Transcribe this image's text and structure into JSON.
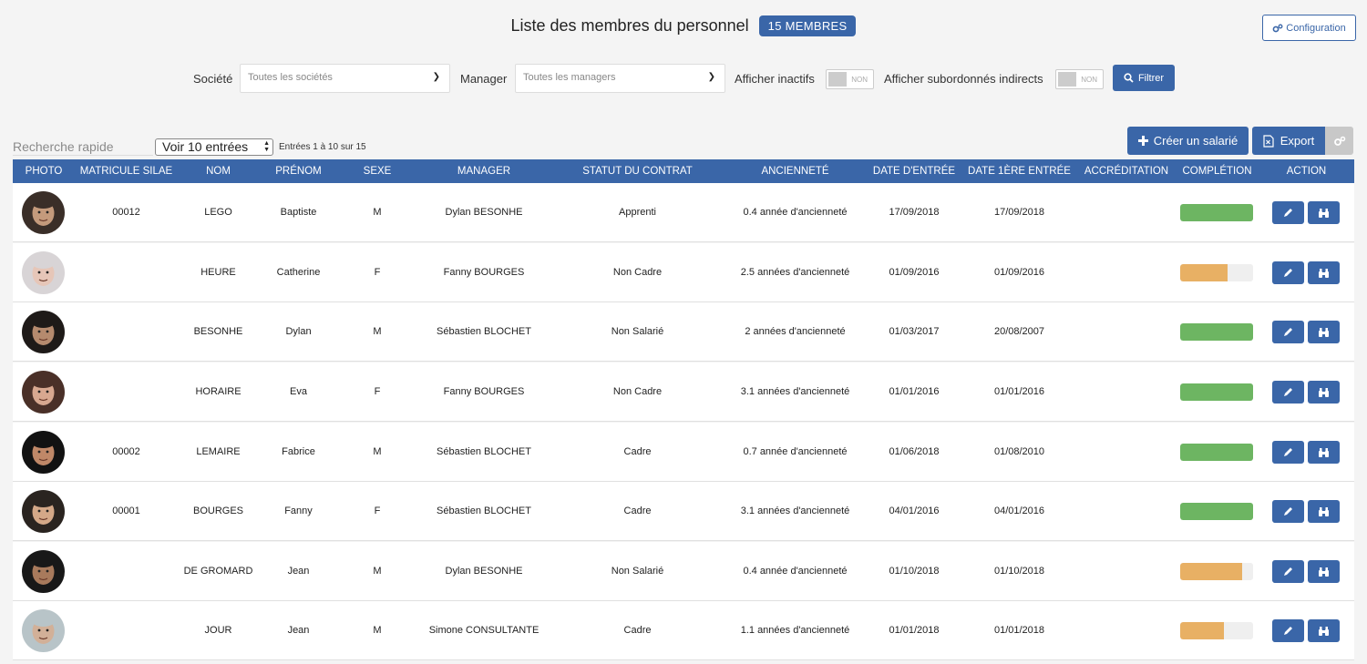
{
  "header": {
    "title": "Liste des membres du personnel",
    "badge": "15 MEMBRES",
    "config_label": "Configuration"
  },
  "filters": {
    "societe_label": "Société",
    "societe_value": "Toutes les sociétés",
    "manager_label": "Manager",
    "manager_value": "Toutes les managers",
    "inactifs_label": "Afficher inactifs",
    "inactifs_toggle": "NON",
    "subordonnes_label": "Afficher subordonnés indirects",
    "subordonnes_toggle": "NON",
    "filter_button": "Filtrer"
  },
  "table_controls": {
    "search_placeholder": "Recherche rapide",
    "length_select": "Voir 10 entrées",
    "entries_info": "Entrées 1 à 10 sur 15",
    "create_button": "Créer un salarié",
    "export_button": "Export"
  },
  "columns": [
    "PHOTO",
    "MATRICULE SILAE",
    "NOM",
    "PRÉNOM",
    "SEXE",
    "MANAGER",
    "STATUT DU CONTRAT",
    "ANCIENNETÉ",
    "DATE D'ENTRÉE",
    "DATE 1ÈRE ENTRÉE",
    "ACCRÉDITATION",
    "COMPLÉTION",
    "ACTION"
  ],
  "colors": {
    "primary": "#3a66a8",
    "complete": "#6db562",
    "partial": "#e8b064",
    "background": "#f4f4f4"
  },
  "rows": [
    {
      "matricule": "00012",
      "nom": "LEGO",
      "prenom": "Baptiste",
      "sexe": "M",
      "manager": "Dylan BESONHE",
      "statut": "Apprenti",
      "anciennete": "0.4 année d'ancienneté",
      "date_entree": "17/09/2018",
      "date_premiere": "17/09/2018",
      "accreditation": "",
      "completion": 1.0,
      "bg": "#3a2e28",
      "skin": "#c49a7c"
    },
    {
      "matricule": "",
      "nom": "HEURE",
      "prenom": "Catherine",
      "sexe": "F",
      "manager": "Fanny BOURGES",
      "statut": "Non Cadre",
      "anciennete": "2.5 années d'ancienneté",
      "date_entree": "01/09/2016",
      "date_premiere": "01/09/2016",
      "accreditation": "",
      "completion": 0.65,
      "bg": "#d8d4d6",
      "skin": "#e6c6b8"
    },
    {
      "matricule": "",
      "nom": "BESONHE",
      "prenom": "Dylan",
      "sexe": "M",
      "manager": "Sébastien BLOCHET",
      "statut": "Non Salarié",
      "anciennete": "2 années d'ancienneté",
      "date_entree": "01/03/2017",
      "date_premiere": "20/08/2007",
      "accreditation": "",
      "completion": 1.0,
      "bg": "#1e1a18",
      "skin": "#b58a6e"
    },
    {
      "matricule": "",
      "nom": "HORAIRE",
      "prenom": "Eva",
      "sexe": "F",
      "manager": "Fanny BOURGES",
      "statut": "Non Cadre",
      "anciennete": "3.1 années d'ancienneté",
      "date_entree": "01/01/2016",
      "date_premiere": "01/01/2016",
      "accreditation": "",
      "completion": 1.0,
      "bg": "#4a3028",
      "skin": "#d8a890"
    },
    {
      "matricule": "00002",
      "nom": "LEMAIRE",
      "prenom": "Fabrice",
      "sexe": "M",
      "manager": "Sébastien BLOCHET",
      "statut": "Cadre",
      "anciennete": "0.7 année d'ancienneté",
      "date_entree": "01/06/2018",
      "date_premiere": "01/08/2010",
      "accreditation": "",
      "completion": 1.0,
      "bg": "#121212",
      "skin": "#c08868"
    },
    {
      "matricule": "00001",
      "nom": "BOURGES",
      "prenom": "Fanny",
      "sexe": "F",
      "manager": "Sébastien BLOCHET",
      "statut": "Cadre",
      "anciennete": "3.1 années d'ancienneté",
      "date_entree": "04/01/2016",
      "date_premiere": "04/01/2016",
      "accreditation": "",
      "completion": 1.0,
      "bg": "#2a2420",
      "skin": "#d4a888"
    },
    {
      "matricule": "",
      "nom": "DE GROMARD",
      "prenom": "Jean",
      "sexe": "M",
      "manager": "Dylan BESONHE",
      "statut": "Non Salarié",
      "anciennete": "0.4 année d'ancienneté",
      "date_entree": "01/10/2018",
      "date_premiere": "01/10/2018",
      "accreditation": "",
      "completion": 0.85,
      "bg": "#181818",
      "skin": "#a87a5c"
    },
    {
      "matricule": "",
      "nom": "JOUR",
      "prenom": "Jean",
      "sexe": "M",
      "manager": "Simone CONSULTANTE",
      "statut": "Cadre",
      "anciennete": "1.1 années d'ancienneté",
      "date_entree": "01/01/2018",
      "date_premiere": "01/01/2018",
      "accreditation": "",
      "completion": 0.6,
      "bg": "#b8c4c8",
      "skin": "#d2b098"
    }
  ]
}
